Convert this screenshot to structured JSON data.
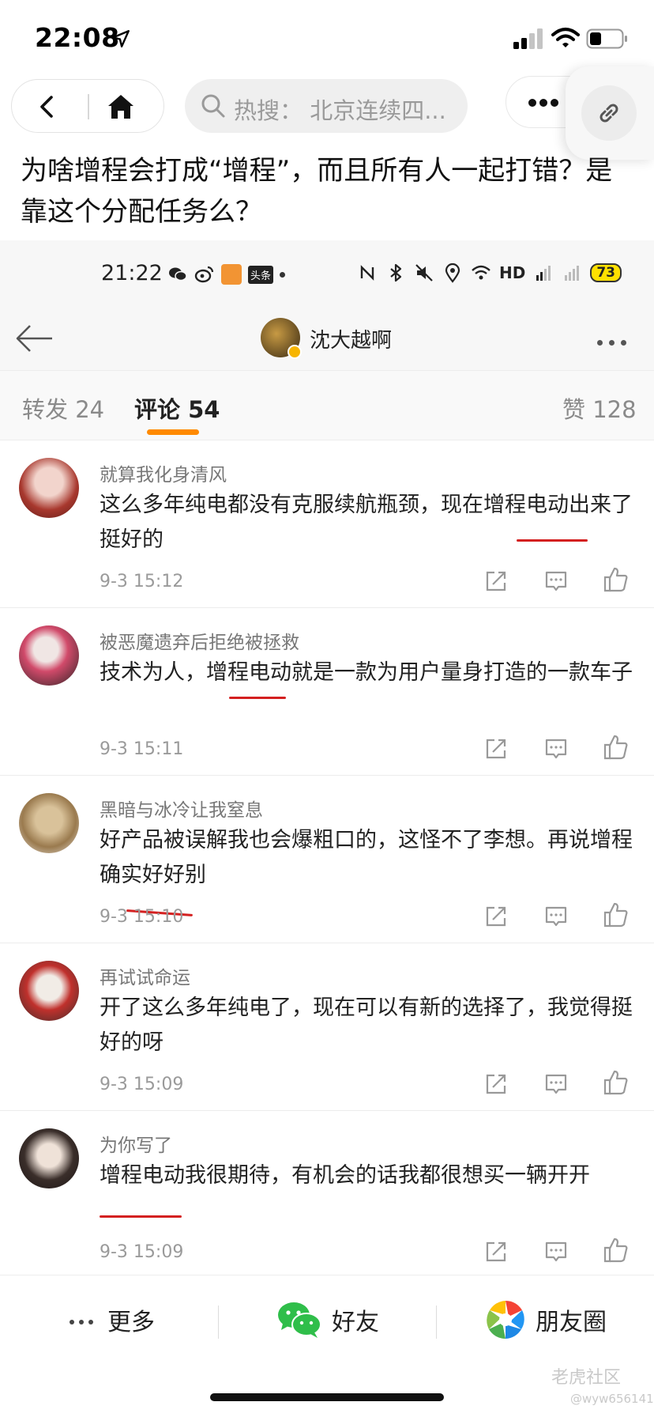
{
  "status_bar": {
    "time": "22:08"
  },
  "search": {
    "placeholder": "热搜：  北京连续四..."
  },
  "question": "为啥增程会打成“增程”，而且所有人一起打错？是靠这个分配任务么？",
  "inner": {
    "status_time": "21:22",
    "toutiao_badge": "头条",
    "hd_label": "HD",
    "battery": "73",
    "author": "沈大越啊",
    "tabs": {
      "repost": "转发 24",
      "comment": "评论 54",
      "like": "赞 128"
    },
    "comments": [
      {
        "user": "就算我化身清风",
        "text": "这么多年纯电都没有克服续航瓶颈，现在增程电动出来了挺好的",
        "time": "9-3 15:12"
      },
      {
        "user": "被恶魔遗弃后拒绝被拯救",
        "text": "技术为人，增程电动就是一款为用户量身打造的一款车子",
        "time": "9-3 15:11"
      },
      {
        "user": "黑暗与冰冷让我窒息",
        "text": "好产品被误解我也会爆粗口的，这怪不了李想。再说增程确实好好别",
        "time": "9-3 15:10"
      },
      {
        "user": "再试试命运",
        "text": "开了这么多年纯电了，现在可以有新的选择了，我觉得挺好的呀",
        "time": "9-3 15:09"
      },
      {
        "user": "为你写了",
        "text": "增程电动我很期待，有机会的话我都很想买一辆开开",
        "time": "9-3 15:09"
      }
    ]
  },
  "share_bar": {
    "more": "更多",
    "friend": "好友",
    "moments": "朋友圈"
  },
  "watermark": {
    "brand": "老虎社区",
    "user": "@wyw656141"
  },
  "colors": {
    "accent": "#ff8a00",
    "underline_red": "#d42020"
  }
}
